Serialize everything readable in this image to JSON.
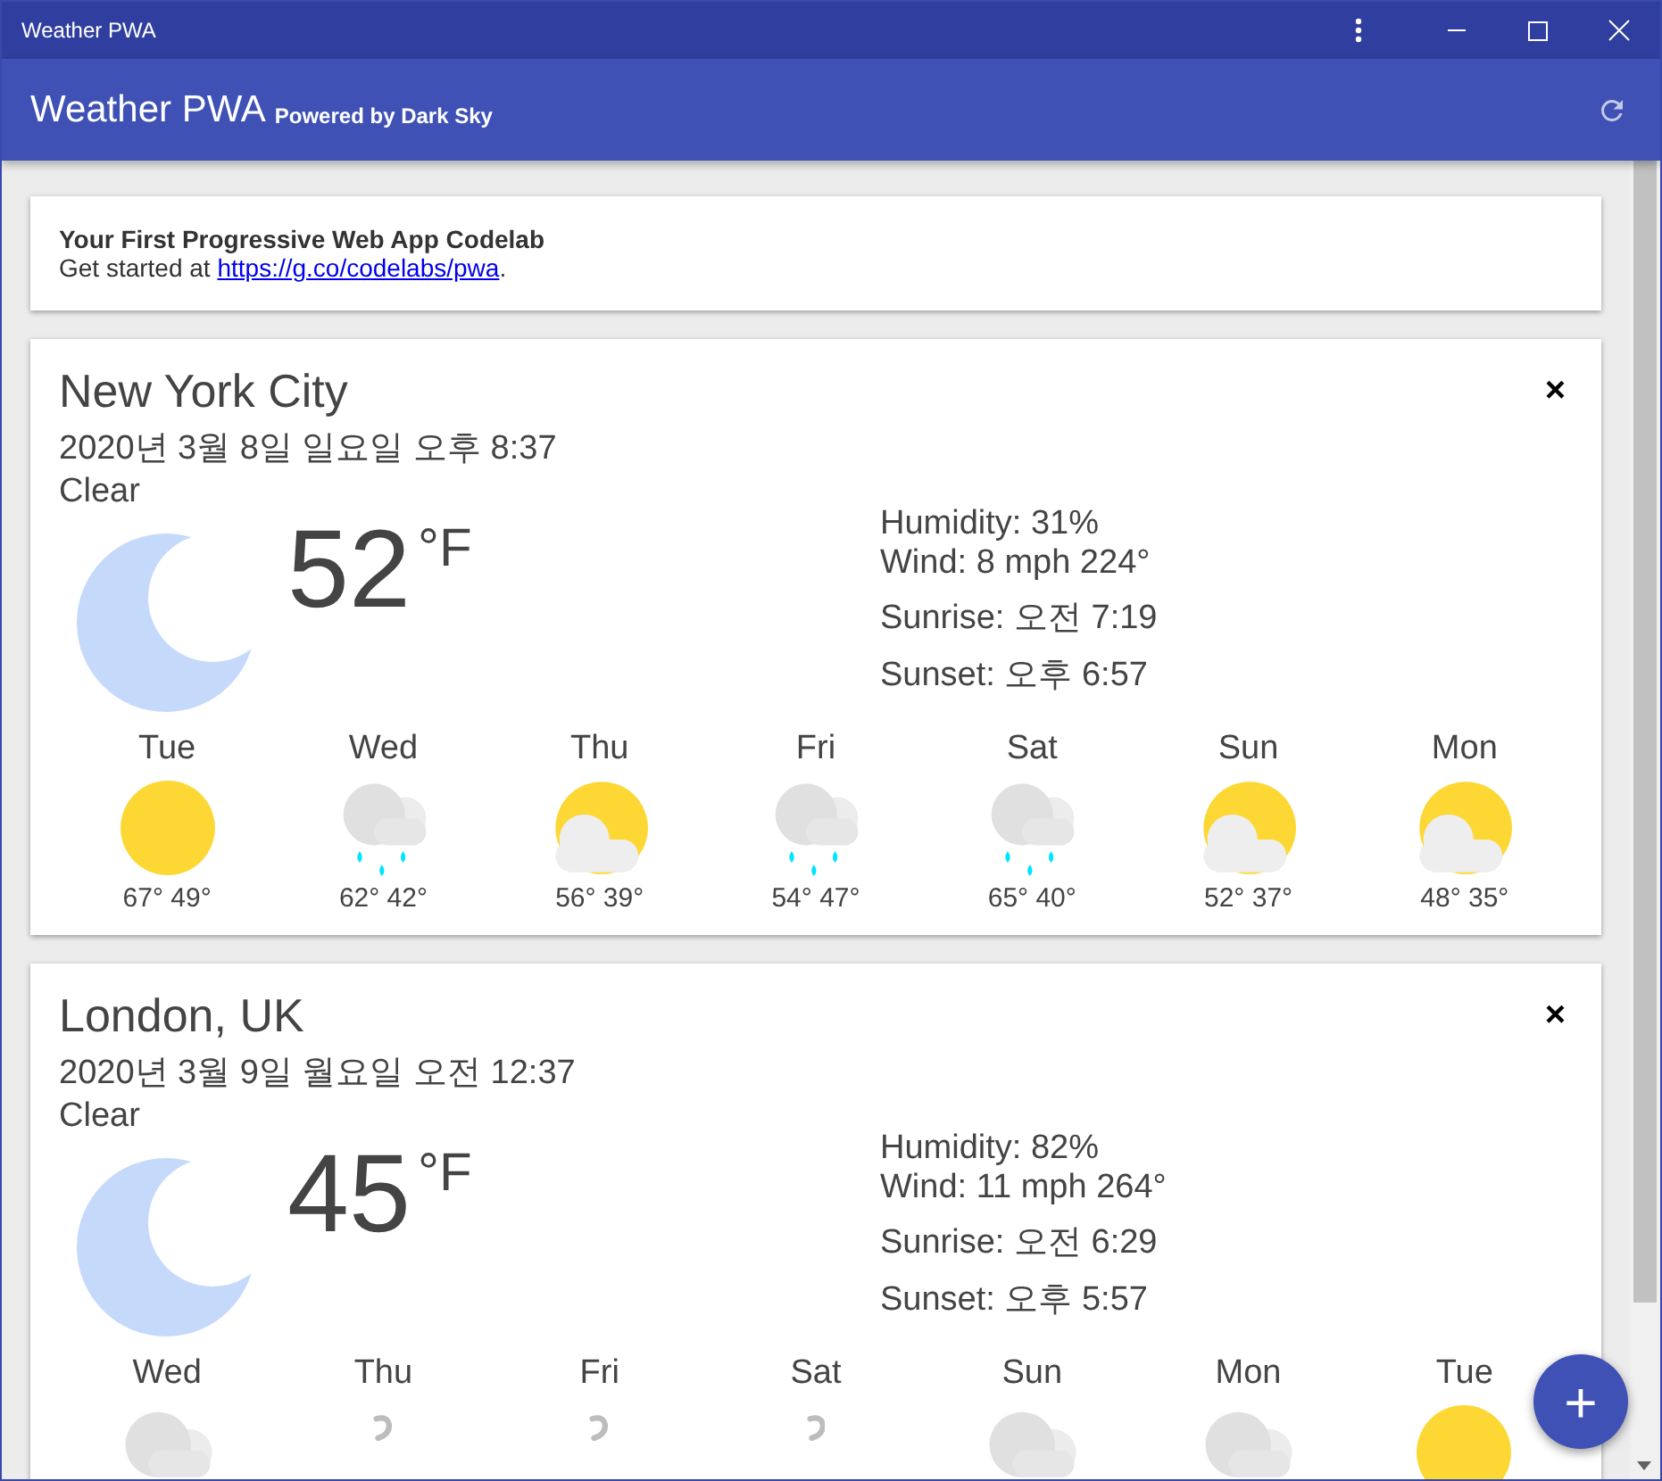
{
  "window": {
    "title": "Weather PWA"
  },
  "header": {
    "title": "Weather PWA",
    "subtitle": "Powered by Dark Sky"
  },
  "intro": {
    "title": "Your First Progressive Web App Codelab",
    "text": "Get started at ",
    "link": "https://g.co/codelabs/pwa",
    "after": "."
  },
  "locations": [
    {
      "city": "New York City",
      "date": "2020년 3월 8일 일요일 오후 8:37",
      "description": "Clear",
      "kind": "clear-night",
      "temperature": "52",
      "unit": "°F",
      "humidity": "Humidity: 31%",
      "wind": "Wind: 8 mph 224°",
      "sunrise": "Sunrise: 오전 7:19",
      "sunset": "Sunset: 오후 6:57",
      "close": "×",
      "forecast": [
        {
          "day": "Tue",
          "kind": "clear-day",
          "temps": "67° 49°"
        },
        {
          "day": "Wed",
          "kind": "rain",
          "temps": "62° 42°"
        },
        {
          "day": "Thu",
          "kind": "partly-cloudy",
          "temps": "56° 39°"
        },
        {
          "day": "Fri",
          "kind": "rain",
          "temps": "54° 47°"
        },
        {
          "day": "Sat",
          "kind": "rain",
          "temps": "65° 40°"
        },
        {
          "day": "Sun",
          "kind": "partly-cloudy",
          "temps": "52° 37°"
        },
        {
          "day": "Mon",
          "kind": "partly-cloudy",
          "temps": "48° 35°"
        }
      ]
    },
    {
      "city": "London, UK",
      "date": "2020년 3월 9일 월요일 오전 12:37",
      "description": "Clear",
      "kind": "clear-night",
      "temperature": "45",
      "unit": "°F",
      "humidity": "Humidity: 82%",
      "wind": "Wind: 11 mph 264°",
      "sunrise": "Sunrise: 오전 6:29",
      "sunset": "Sunset: 오후 5:57",
      "close": "×",
      "forecast": [
        {
          "day": "Wed",
          "kind": "cloudy"
        },
        {
          "day": "Thu",
          "kind": "wind"
        },
        {
          "day": "Fri",
          "kind": "wind"
        },
        {
          "day": "Sat",
          "kind": "wind"
        },
        {
          "day": "Sun",
          "kind": "cloudy"
        },
        {
          "day": "Mon",
          "kind": "cloudy"
        },
        {
          "day": "Tue",
          "kind": "clear-day"
        }
      ]
    }
  ],
  "fab": "+"
}
